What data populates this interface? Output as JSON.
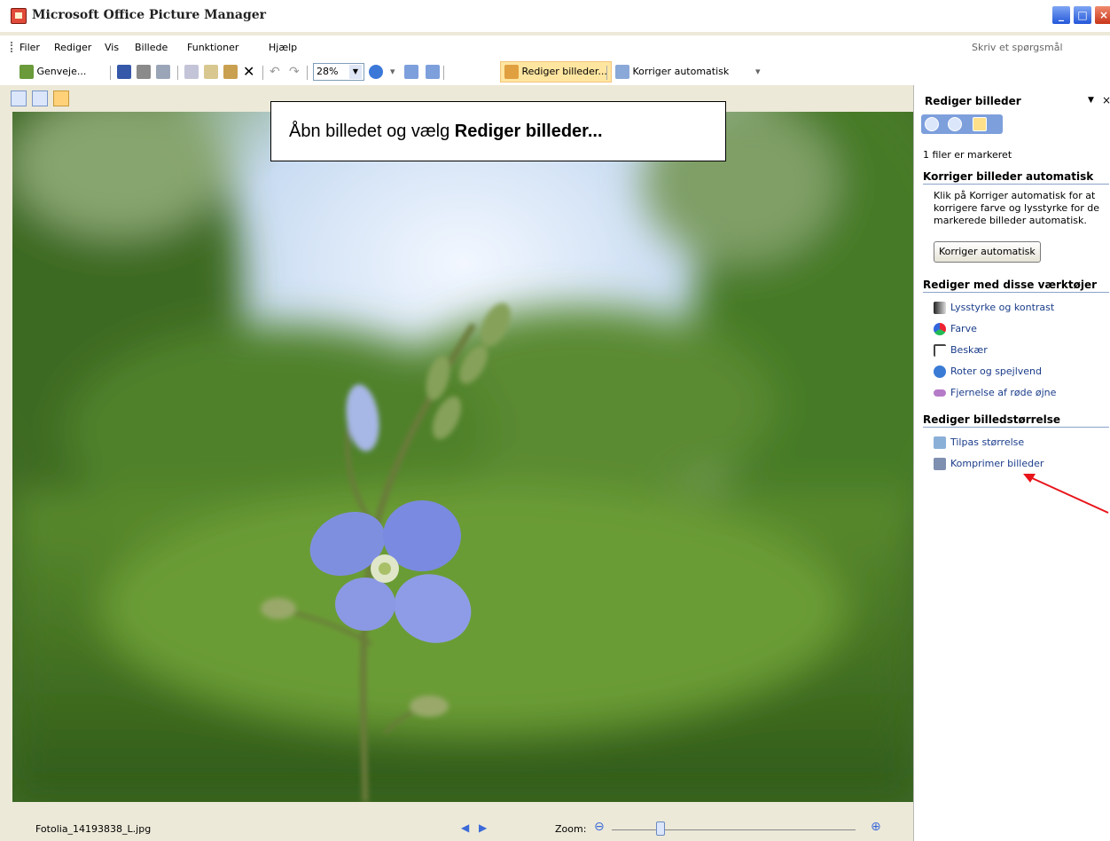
{
  "window": {
    "title": "Microsoft Office Picture Manager"
  },
  "menu": {
    "items": [
      "Filer",
      "Rediger",
      "Vis",
      "Billede",
      "Funktioner",
      "Hjælp"
    ],
    "ask_placeholder": "Skriv et spørgsmål"
  },
  "toolbar": {
    "shortcuts_label": "Genveje...",
    "zoom_value": "28%",
    "edit_pictures_label": "Rediger billeder...",
    "auto_correct_label": "Korriger automatisk"
  },
  "callout": {
    "text_prefix": "Åbn billedet og vælg ",
    "text_bold": "Rediger billeder..."
  },
  "status": {
    "filename": "Fotolia_14193838_L.jpg",
    "zoom_label": "Zoom:",
    "zoom_level": 0.2
  },
  "panel": {
    "title": "Rediger billeder",
    "files_selected": "1 filer er markeret",
    "section_auto": "Korriger billeder automatisk",
    "auto_desc_1": "Klik på Korriger automatisk for at",
    "auto_desc_2": "korrigere farve og lysstyrke for de",
    "auto_desc_3": "markerede billeder automatisk.",
    "auto_button": "Korriger automatisk",
    "section_tools": "Rediger med disse værktøjer",
    "tools": [
      "Lysstyrke og kontrast",
      "Farve",
      "Beskær",
      "Roter og spejlvend",
      "Fjernelse af røde øjne"
    ],
    "section_size": "Rediger billedstørrelse",
    "size_tools": [
      "Tilpas størrelse",
      "Komprimer billeder"
    ]
  },
  "colors": {
    "annotation_arrow": "#e8141a",
    "link": "#1a3c8a"
  }
}
